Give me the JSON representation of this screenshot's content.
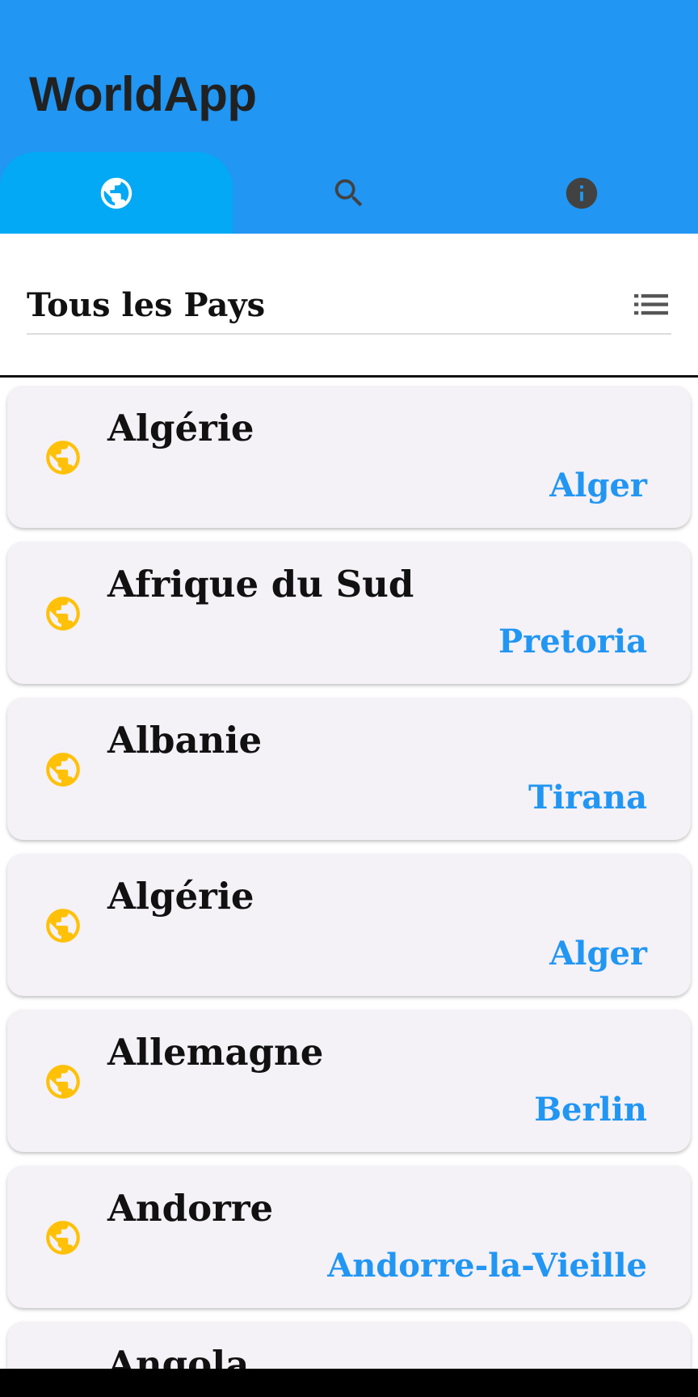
{
  "app": {
    "title": "WorldApp"
  },
  "tabs": [
    {
      "icon": "globe-icon",
      "active": true
    },
    {
      "icon": "search-icon",
      "active": false
    },
    {
      "icon": "info-icon",
      "active": false
    }
  ],
  "section": {
    "title": "Tous les Pays",
    "view_icon": "list-icon"
  },
  "countries": [
    {
      "name": "Algérie",
      "capital": "Alger"
    },
    {
      "name": "Afrique du Sud",
      "capital": "Pretoria"
    },
    {
      "name": "Albanie",
      "capital": "Tirana"
    },
    {
      "name": "Algérie",
      "capital": "Alger"
    },
    {
      "name": "Allemagne",
      "capital": "Berlin"
    },
    {
      "name": "Andorre",
      "capital": "Andorre-la-Vieille"
    },
    {
      "name": "Angola",
      "capital": ""
    }
  ],
  "colors": {
    "appbar": "#2196f3",
    "active_tab": "#03a9f4",
    "card": "#f4f1f7",
    "capital_text": "#2196f3",
    "globe": "#ffc107"
  }
}
